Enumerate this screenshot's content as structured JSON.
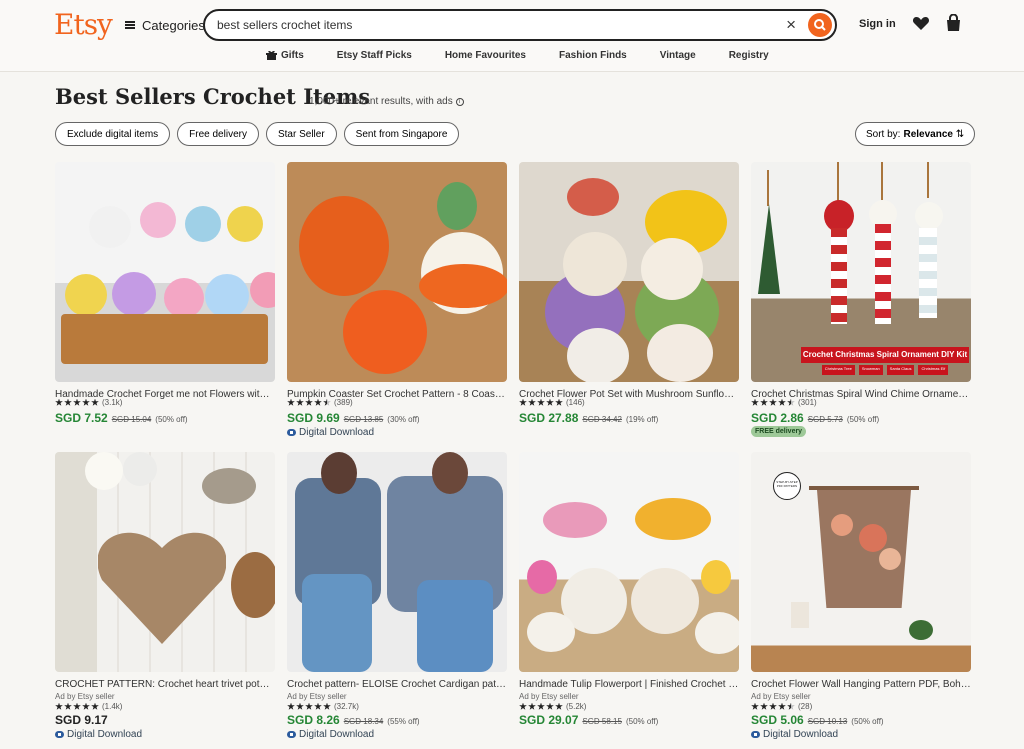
{
  "header": {
    "logo": "Etsy",
    "categories": "Categories",
    "search_value": "best sellers crochet items",
    "signin": "Sign in"
  },
  "nav": [
    "Gifts",
    "Etsy Staff Picks",
    "Home Favourites",
    "Fashion Finds",
    "Vintage",
    "Registry"
  ],
  "page": {
    "title": "Best Sellers Crochet Items",
    "subtitle": "1,000+ relevant results, with ads",
    "filters": [
      "Exclude digital items",
      "Free delivery",
      "Star Seller",
      "Sent from Singapore"
    ],
    "sort_label": "Sort by:",
    "sort_value": "Relevance"
  },
  "products": [
    {
      "title": "Handmade Crochet Forget me not Flowers with H...",
      "rating": 5,
      "count": "(3.1k)",
      "price": "SGD 7.52",
      "old_price": "SGD 15.04",
      "off": "(50% off)"
    },
    {
      "title": "Pumpkin Coaster Set Crochet Pattern - 8 Coaster...",
      "rating": 4.5,
      "count": "(389)",
      "price": "SGD 9.69",
      "old_price": "SGD 13.85",
      "off": "(30% off)",
      "download": "Digital Download"
    },
    {
      "title": "Crochet Flower Pot Set with Mushroom Sunflowe...",
      "rating": 5,
      "count": "(146)",
      "price": "SGD 27.88",
      "old_price": "SGD 34.42",
      "off": "(19% off)"
    },
    {
      "title": "Crochet Christmas Spiral Wind Chime Ornament ...",
      "rating": 4.5,
      "count": "(301)",
      "price": "SGD 2.86",
      "old_price": "SGD 5.73",
      "off": "(50% off)",
      "badge": "FREE delivery",
      "image_text": {
        "title": "Crochet Christmas Spiral Ornament DIY Kit",
        "tags": [
          "Christmas Tree",
          "Snowman",
          "Santa Claus",
          "Christmas Elf"
        ]
      }
    },
    {
      "title": "CROCHET PATTERN: Crochet heart trivet pothol...",
      "ad": "Ad by Etsy seller",
      "rating": 5,
      "count": "(1.4k)",
      "price": "SGD 9.17",
      "download": "Digital Download"
    },
    {
      "title": "Crochet pattern- ELOISE Crochet Cardigan patter...",
      "ad": "Ad by Etsy seller",
      "rating": 5,
      "count": "(32.7k)",
      "price": "SGD 8.26",
      "old_price": "SGD 18.34",
      "off": "(55% off)",
      "download": "Digital Download"
    },
    {
      "title": "Handmade Tulip Flowerport | Finished Crochet W...",
      "ad": "Ad by Etsy seller",
      "rating": 5,
      "count": "(5.2k)",
      "price": "SGD 29.07",
      "old_price": "SGD 58.15",
      "off": "(50% off)"
    },
    {
      "title": "Crochet Flower Wall Hanging Pattern PDF, Boho ...",
      "ad": "Ad by Etsy seller",
      "rating": 4.5,
      "count": "(28)",
      "price": "SGD 5.06",
      "old_price": "SGD 10.13",
      "off": "(50% off)",
      "download": "Digital Download",
      "image_text": {
        "badge": "STEP-BY-STEP PDF PATTERN"
      }
    }
  ],
  "colors": {
    "brand": "#f1641e",
    "price": "#258635"
  }
}
